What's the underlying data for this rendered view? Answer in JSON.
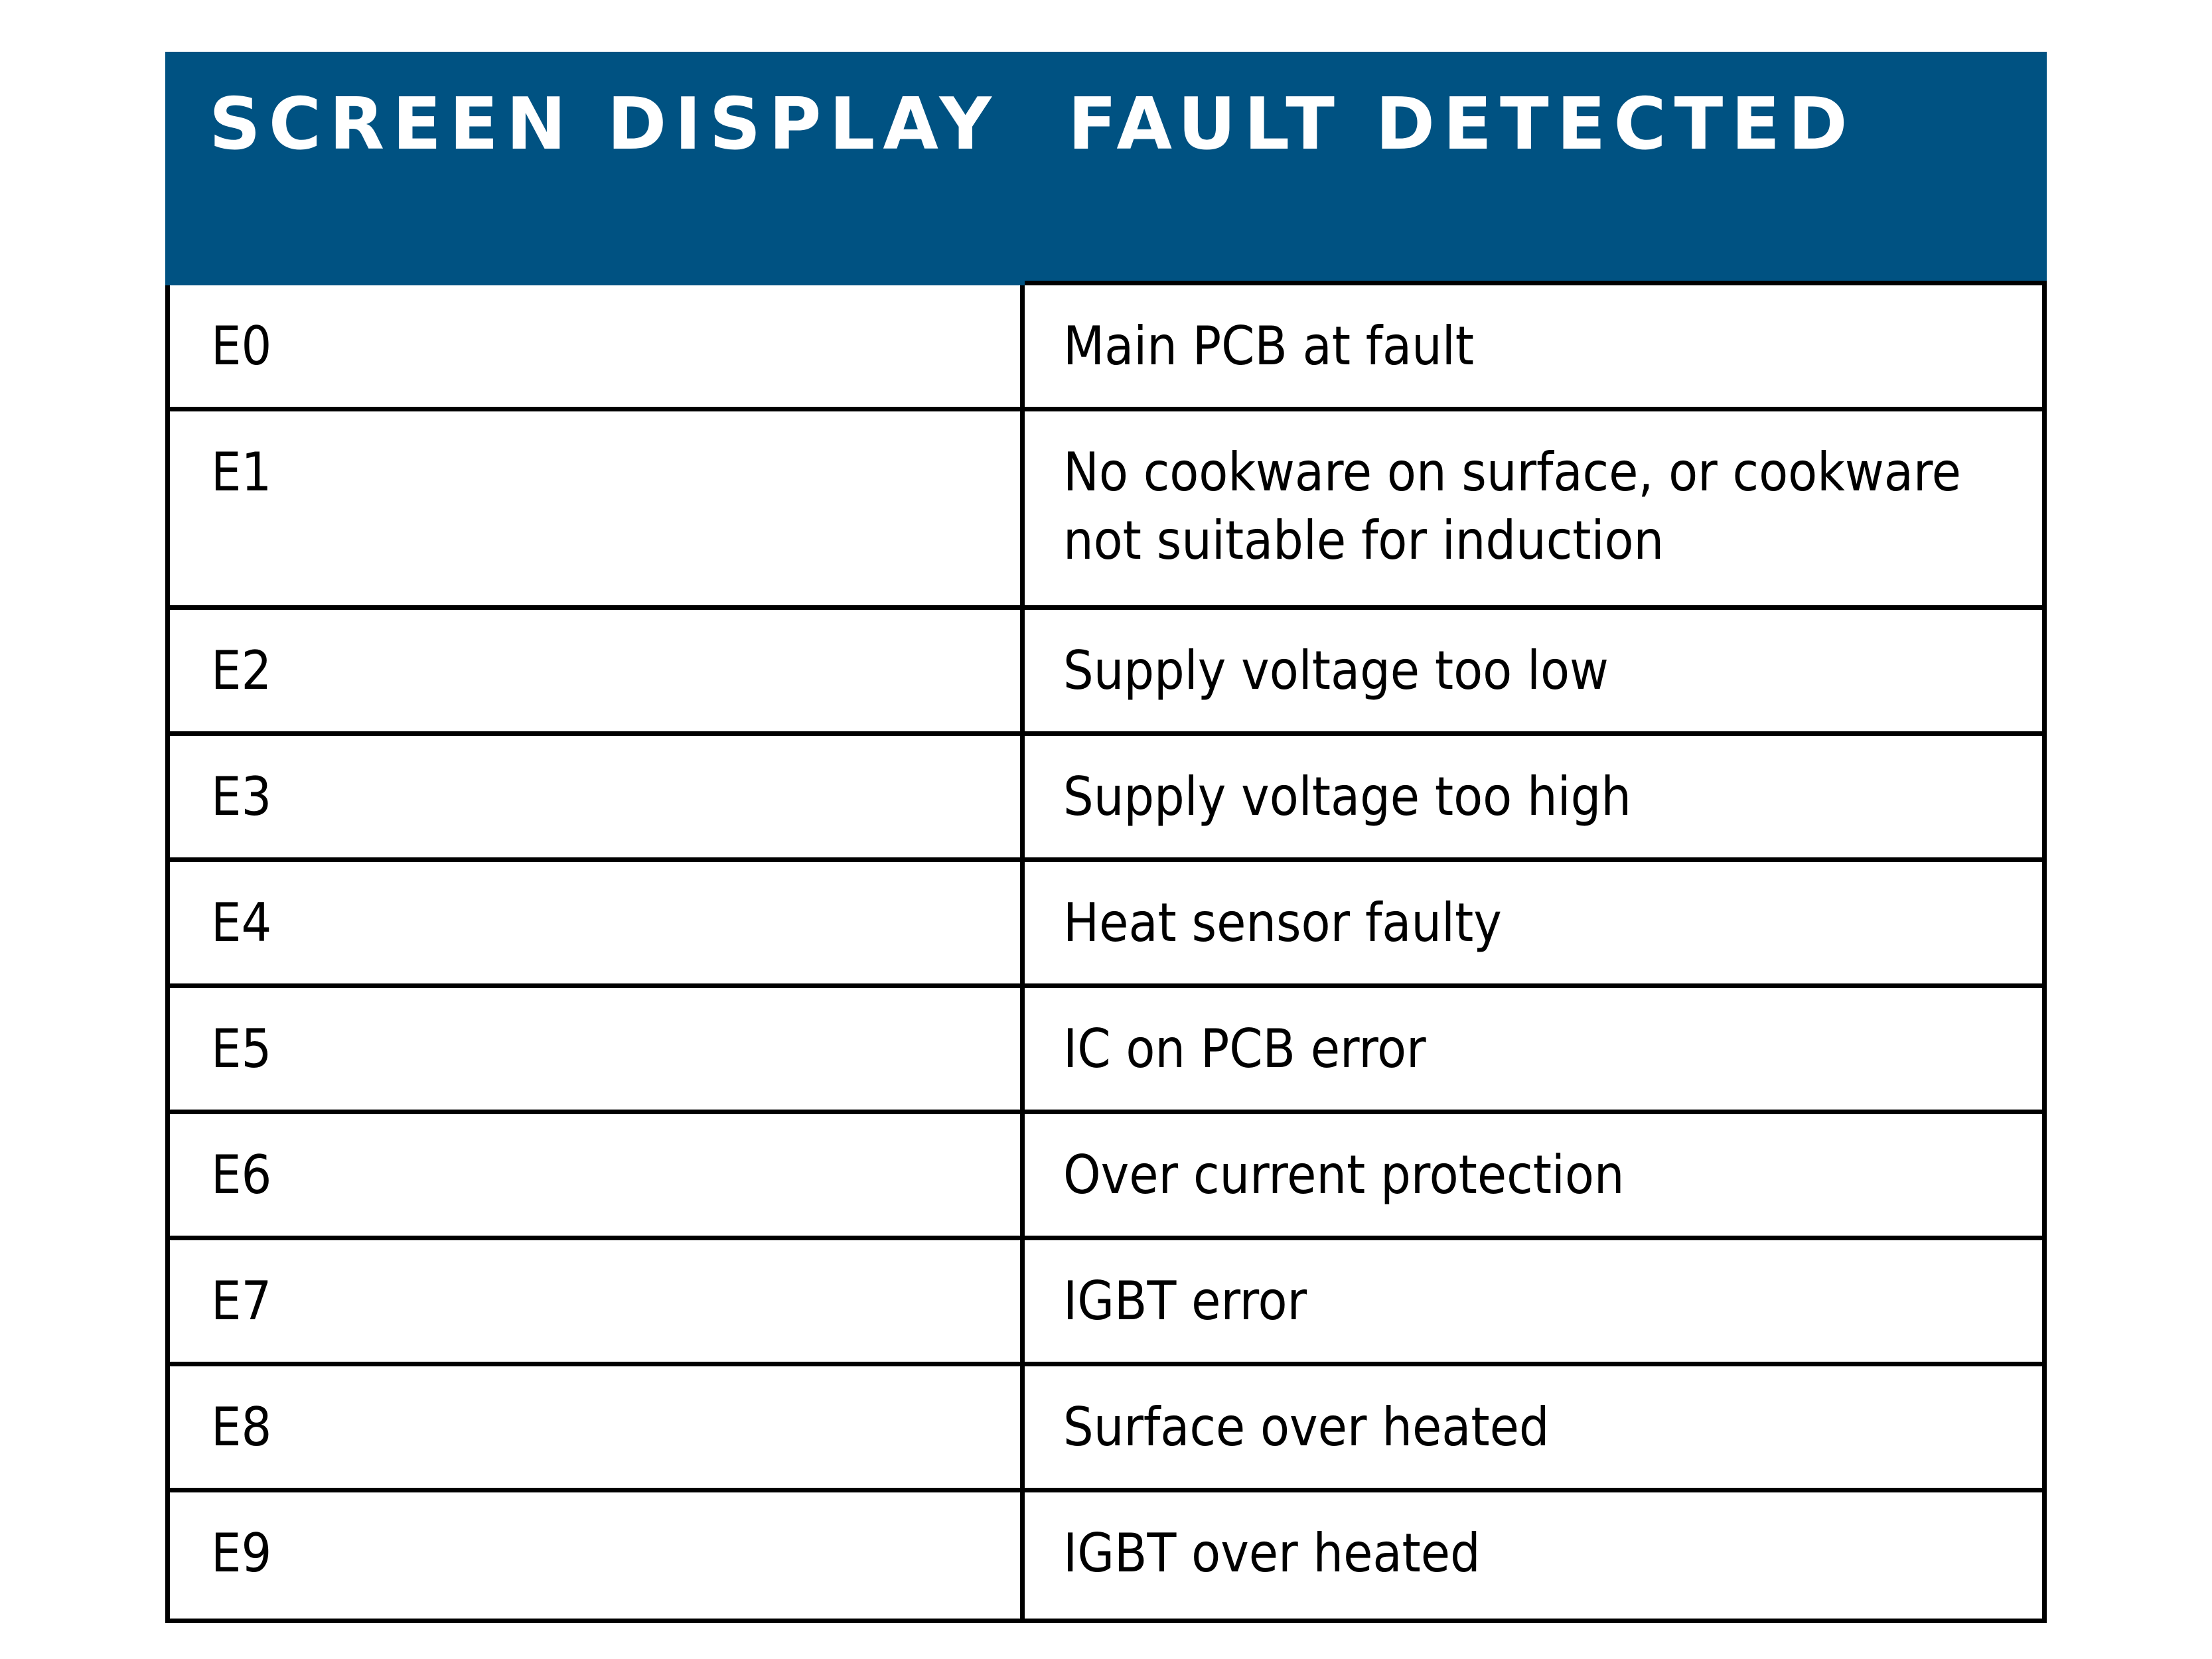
{
  "table": {
    "header": {
      "col1": "SCREEN DISPLAY",
      "col2": "FAULT DETECTED",
      "background_color": "#005282"
    },
    "rows": [
      {
        "code": "E0",
        "fault": "Main PCB at fault"
      },
      {
        "code": "E1",
        "fault": "No cookware on surface, or cookware not suitable for induction"
      },
      {
        "code": "E2",
        "fault": "Supply voltage too low"
      },
      {
        "code": "E3",
        "fault": "Supply voltage too high"
      },
      {
        "code": "E4",
        "fault": "Heat sensor faulty"
      },
      {
        "code": "E5",
        "fault": "IC on PCB error"
      },
      {
        "code": "E6",
        "fault": "Over current protection"
      },
      {
        "code": "E7",
        "fault": "IGBT error"
      },
      {
        "code": "E8",
        "fault": "Surface over heated"
      },
      {
        "code": "E9",
        "fault": "IGBT over heated"
      }
    ]
  }
}
